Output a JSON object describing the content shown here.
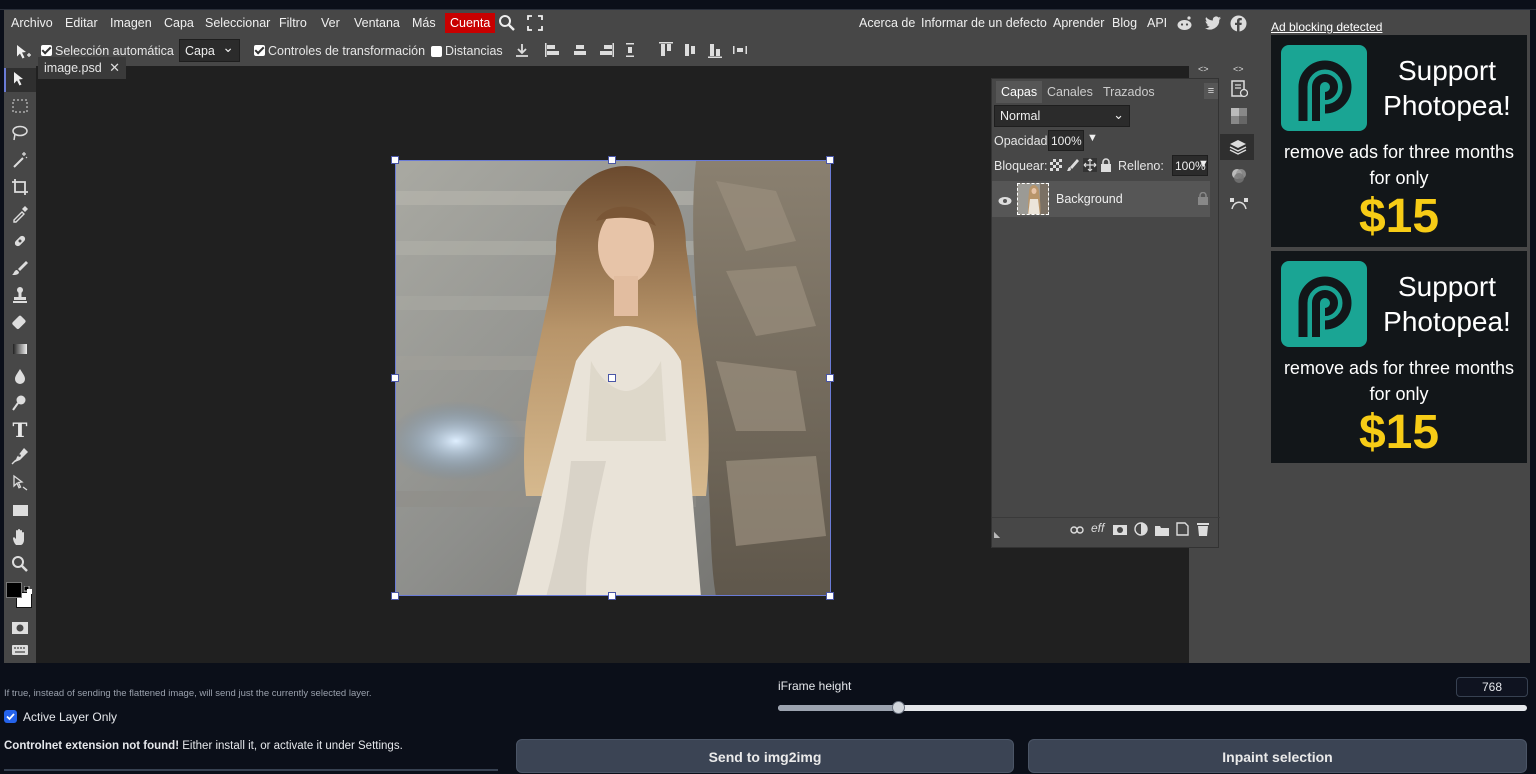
{
  "menu": {
    "items": [
      "Archivo",
      "Editar",
      "Imagen",
      "Capa",
      "Seleccionar",
      "Filtro",
      "Ver",
      "Ventana",
      "Más"
    ],
    "cuenta": "Cuenta",
    "right_items": [
      "Acerca de",
      "Informar de un defecto",
      "Aprender",
      "Blog",
      "API"
    ]
  },
  "options": {
    "auto_select": "Selección automática",
    "auto_select_target": "Capa",
    "transform_controls": "Controles de transformación",
    "distances": "Distancias"
  },
  "document": {
    "tab_name": "image.psd"
  },
  "layers_panel": {
    "tabs": [
      "Capas",
      "Canales",
      "Trazados"
    ],
    "blend_mode": "Normal",
    "opacity_label": "Opacidad:",
    "opacity_value": "100%",
    "lock_label": "Bloquear:",
    "fill_label": "Relleno:",
    "fill_value": "100%",
    "layer_name": "Background",
    "footer_fx": "eff"
  },
  "sidebar": {
    "ad_blocking": "Ad blocking detected",
    "ad_title": "Support Photopea!",
    "ad_sub": "remove ads for three months for only",
    "ad_price": "$15"
  },
  "below": {
    "hint": "If true, instead of sending the flattened image, will send just the currently selected layer.",
    "active_layer_label": "Active Layer Only",
    "iframe_label": "iFrame height",
    "iframe_value": "768",
    "iframe_slider_fraction": 0.16,
    "controlnet_bold": "Controlnet extension not found!",
    "controlnet_rest": " Either install it, or activate it under Settings.",
    "send_button": "Send to img2img",
    "inpaint_button": "Inpaint selection"
  },
  "colors": {
    "accent_cuenta": "#c80000",
    "ad_price": "#f7cc16",
    "ad_logo": "#1aa594",
    "selection_border": "#6a7bd6",
    "page_bg": "#0b0f19"
  }
}
